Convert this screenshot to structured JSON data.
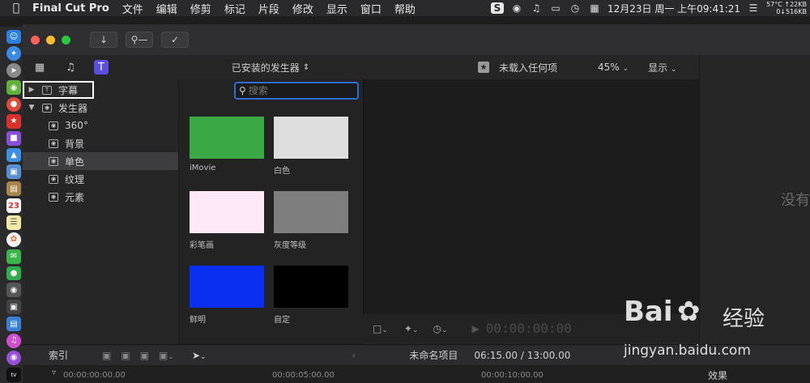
{
  "menubar": {
    "app_name": "Final Cut Pro",
    "menus": [
      "文件",
      "编辑",
      "修剪",
      "标记",
      "片段",
      "修改",
      "显示",
      "窗口",
      "帮助"
    ],
    "clock": "12月23日 周一 上午09:41:21",
    "temperature": "57°C",
    "net_up": "↑22KB",
    "net_down": "0↓516KB"
  },
  "library_tabs": [
    "clapper-icon",
    "audio-icon",
    "titles-generators-icon"
  ],
  "sidebar": {
    "items": [
      {
        "label": "字幕",
        "level": 0,
        "expanded": false
      },
      {
        "label": "发生器",
        "level": 0,
        "expanded": true
      },
      {
        "label": "360°",
        "level": 1
      },
      {
        "label": "背景",
        "level": 1
      },
      {
        "label": "单色",
        "level": 1,
        "selected": true
      },
      {
        "label": "纹理",
        "level": 1
      },
      {
        "label": "元素",
        "level": 1
      }
    ]
  },
  "generators": {
    "filter_label": "已安装的发生器",
    "search_placeholder": "搜索",
    "items": [
      {
        "label": "iMovie",
        "color": "#3aa845"
      },
      {
        "label": "白色",
        "color": "#dedede"
      },
      {
        "label": "彩笔画",
        "color": "#fde8f8"
      },
      {
        "label": "灰度等级",
        "color": "#7e7e7e"
      },
      {
        "label": "鲜明",
        "color": "#0a2ff0"
      },
      {
        "label": "自定",
        "color": "#000000"
      }
    ]
  },
  "viewer": {
    "status": "未载入任何项",
    "zoom": "45%",
    "display_label": "显示",
    "timecode": "00:00:00:00"
  },
  "inspector": {
    "no_selection": "没有"
  },
  "timeline": {
    "index_label": "索引",
    "project_name": "未命名项目",
    "duration": "06:15.00 / 13:00.00",
    "ruler_marks": [
      "00:00:00:00.00",
      "00:00:05:00.00",
      "00:00:10:00.00"
    ],
    "effects_label": "效果"
  },
  "watermark": {
    "brand": "Bai",
    "brand_cn": "经验",
    "url": "jingyan.baidu.com"
  }
}
